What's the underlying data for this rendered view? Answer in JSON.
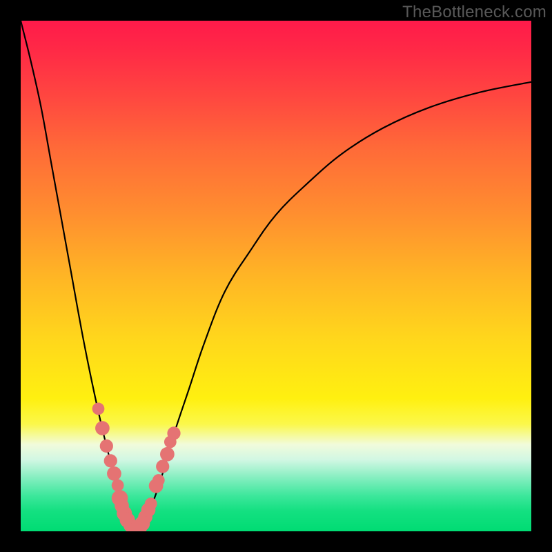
{
  "watermark": "TheBottleneck.com",
  "chart_data": {
    "type": "line",
    "title": "",
    "xlabel": "",
    "ylabel": "",
    "xlim": [
      0,
      100
    ],
    "ylim": [
      0,
      100
    ],
    "series": [
      {
        "name": "bottleneck-curve",
        "x": [
          0,
          2,
          4,
          6,
          8,
          10,
          12,
          14,
          16,
          18,
          19.5,
          21,
          22.5,
          24,
          26,
          28,
          30,
          33,
          36,
          40,
          45,
          50,
          56,
          63,
          71,
          80,
          90,
          100
        ],
        "y": [
          100,
          92,
          83,
          72,
          61,
          50,
          39,
          29,
          20,
          12,
          6,
          2,
          0,
          2,
          6,
          12,
          19,
          28,
          37,
          47,
          55,
          62,
          68,
          74,
          79,
          83,
          86,
          88
        ]
      }
    ],
    "marker_points": {
      "name": "curve-markers",
      "color": "#e57373",
      "points": [
        {
          "x": 15.2,
          "y": 24.0,
          "r": 1.2
        },
        {
          "x": 16.0,
          "y": 20.2,
          "r": 1.4
        },
        {
          "x": 16.8,
          "y": 16.7,
          "r": 1.3
        },
        {
          "x": 17.6,
          "y": 13.8,
          "r": 1.3
        },
        {
          "x": 18.3,
          "y": 11.3,
          "r": 1.4
        },
        {
          "x": 19.0,
          "y": 9.0,
          "r": 1.2
        },
        {
          "x": 19.4,
          "y": 6.5,
          "r": 1.6
        },
        {
          "x": 19.8,
          "y": 5.0,
          "r": 1.4
        },
        {
          "x": 20.3,
          "y": 3.5,
          "r": 1.5
        },
        {
          "x": 20.9,
          "y": 2.2,
          "r": 1.5
        },
        {
          "x": 21.5,
          "y": 1.2,
          "r": 1.4
        },
        {
          "x": 22.1,
          "y": 0.6,
          "r": 1.5
        },
        {
          "x": 22.6,
          "y": 0.2,
          "r": 1.6
        },
        {
          "x": 23.2,
          "y": 0.6,
          "r": 1.5
        },
        {
          "x": 23.8,
          "y": 1.5,
          "r": 1.5
        },
        {
          "x": 24.4,
          "y": 2.8,
          "r": 1.4
        },
        {
          "x": 25.0,
          "y": 4.2,
          "r": 1.4
        },
        {
          "x": 25.5,
          "y": 5.4,
          "r": 1.2
        },
        {
          "x": 26.5,
          "y": 8.9,
          "r": 1.4
        },
        {
          "x": 27.0,
          "y": 10.0,
          "r": 1.2
        },
        {
          "x": 27.8,
          "y": 12.7,
          "r": 1.3
        },
        {
          "x": 28.7,
          "y": 15.1,
          "r": 1.4
        },
        {
          "x": 29.3,
          "y": 17.5,
          "r": 1.2
        },
        {
          "x": 30.0,
          "y": 19.2,
          "r": 1.3
        }
      ]
    }
  }
}
